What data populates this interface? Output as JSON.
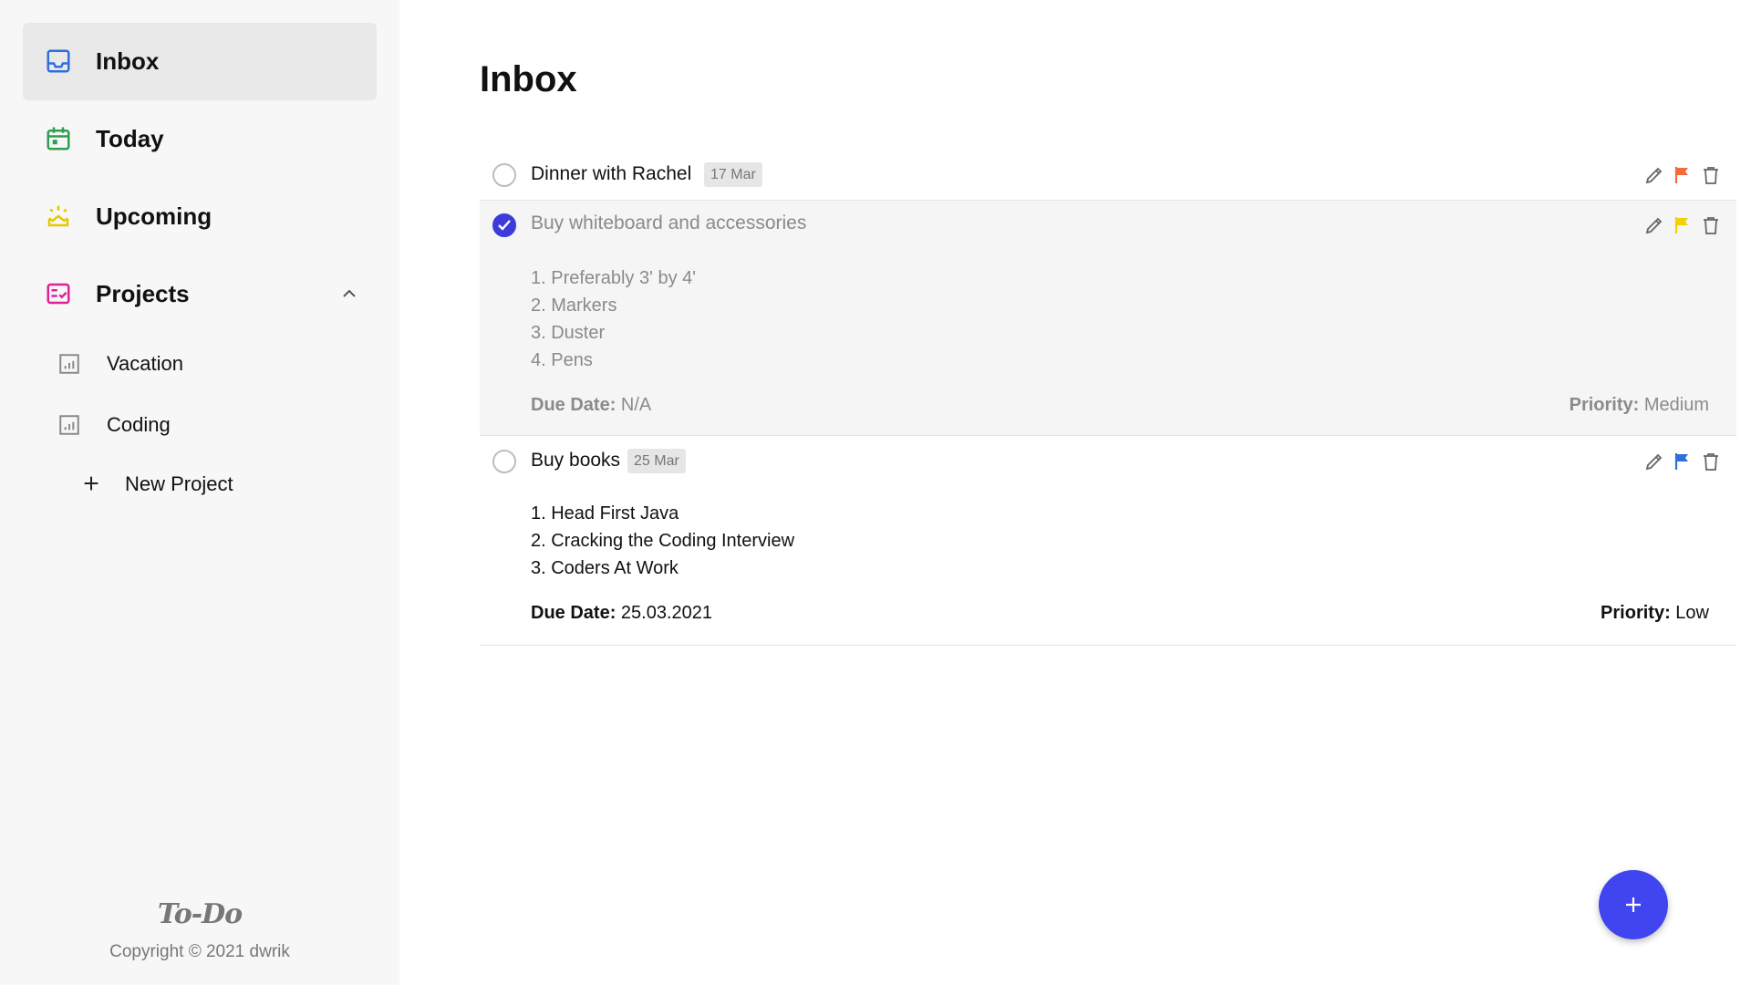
{
  "sidebar": {
    "nav": [
      {
        "label": "Inbox",
        "icon": "inbox-icon",
        "color": "#2f6fdb",
        "active": true
      },
      {
        "label": "Today",
        "icon": "calendar-icon",
        "color": "#2e9e4f"
      },
      {
        "label": "Upcoming",
        "icon": "sunrise-icon",
        "color": "#e6c800"
      },
      {
        "label": "Projects",
        "icon": "checklist-icon",
        "color": "#e0219a"
      }
    ],
    "projects": [
      {
        "label": "Vacation",
        "icon": "chart-icon"
      },
      {
        "label": "Coding",
        "icon": "chart-icon"
      }
    ],
    "new_project_label": "New Project",
    "brand": "To-Do",
    "copyright": "Copyright © 2021 dwrik"
  },
  "main": {
    "title": "Inbox",
    "tasks": [
      {
        "title": "Dinner with Rachel",
        "date": "17 Mar",
        "completed": false,
        "flag_color": "#f26b3a"
      },
      {
        "title": "Buy whiteboard and accessories",
        "completed": true,
        "flag_color": "#f2d100",
        "notes": [
          "1. Preferably 3' by 4'",
          "2. Markers",
          "3. Duster",
          "4. Pens"
        ],
        "due_label": "Due Date:",
        "due_value": "N/A",
        "priority_label": "Priority:",
        "priority_value": "Medium"
      },
      {
        "title": "Buy books",
        "date": "25 Mar",
        "completed": false,
        "flag_color": "#2f6fdb",
        "notes": [
          "1. Head First Java",
          "2. Cracking the Coding Interview",
          "3. Coders At Work"
        ],
        "due_label": "Due Date:",
        "due_value": "25.03.2021",
        "priority_label": "Priority:",
        "priority_value": "Low"
      }
    ]
  },
  "fab": {
    "icon": "plus-icon",
    "color": "#4045ef"
  }
}
